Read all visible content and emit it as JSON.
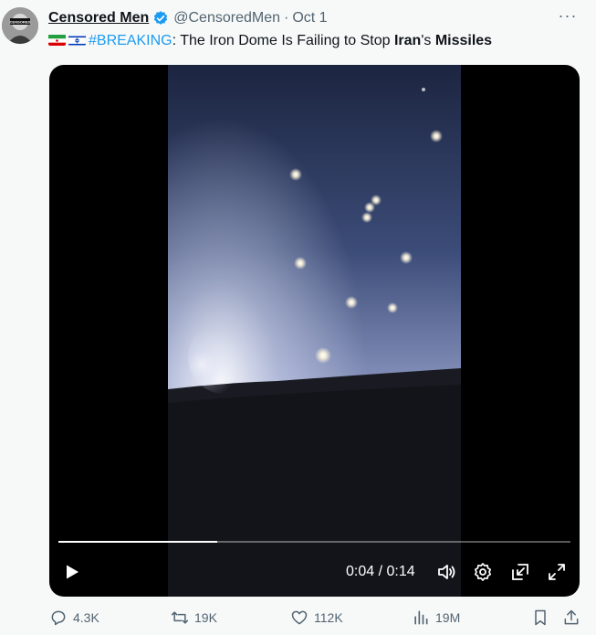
{
  "author": {
    "name": "Censored Men",
    "handle": "@CensoredMen",
    "date": "Oct 1",
    "avatar_text": "CENSORED"
  },
  "tweet": {
    "hashtag": "#BREAKING",
    "text_a": ": The Iron Dome Is Failing to Stop ",
    "bold_a": "Iran",
    "text_b": "'s ",
    "bold_b": "Missiles"
  },
  "video": {
    "current_time": "0:04",
    "separator": " / ",
    "duration": "0:14",
    "progress": 0.31
  },
  "actions": {
    "replies": "4.3K",
    "reposts": "19K",
    "likes": "112K",
    "views": "19M"
  },
  "colors": {
    "accent": "#1d9bf0",
    "muted": "#536471",
    "text": "#0f1419"
  }
}
